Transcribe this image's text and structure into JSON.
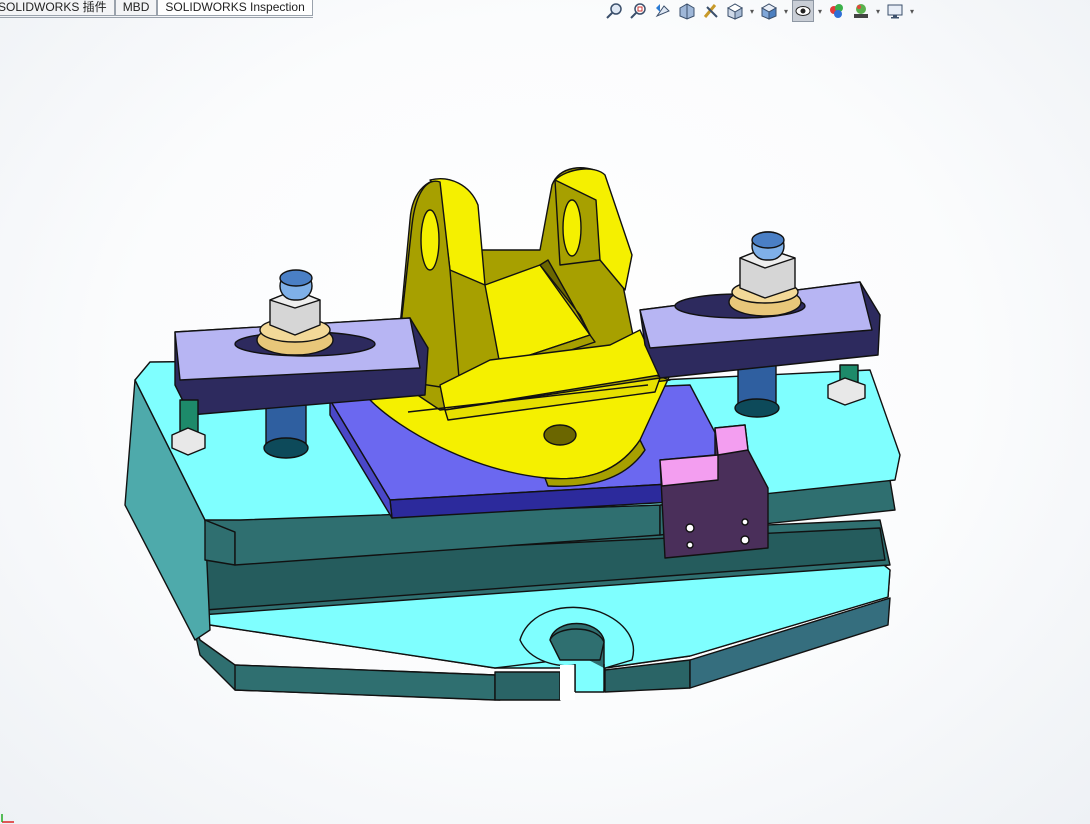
{
  "tabs": [
    {
      "label": "SOLIDWORKS 插件"
    },
    {
      "label": "MBD"
    },
    {
      "label": "SOLIDWORKS Inspection"
    }
  ],
  "view_toolbar": {
    "icons": [
      "zoom-to-fit-icon",
      "zoom-area-icon",
      "previous-view-icon",
      "section-view-icon",
      "dynamic-annotation-icon",
      "view-orientation-icon",
      "display-style-icon",
      "hide-show-items-icon",
      "edit-appearance-icon",
      "apply-scene-icon",
      "view-settings-icon"
    ]
  },
  "colors": {
    "base_cyan": "#7fffff",
    "base_side": "#2f6f70",
    "fixture_yellow": "#f5f000",
    "plate_blue": "#6b68f0",
    "clamp_lavender": "#b7b5f3",
    "washer_gold": "#e8c77a",
    "block_pink": "#f39ef0"
  }
}
